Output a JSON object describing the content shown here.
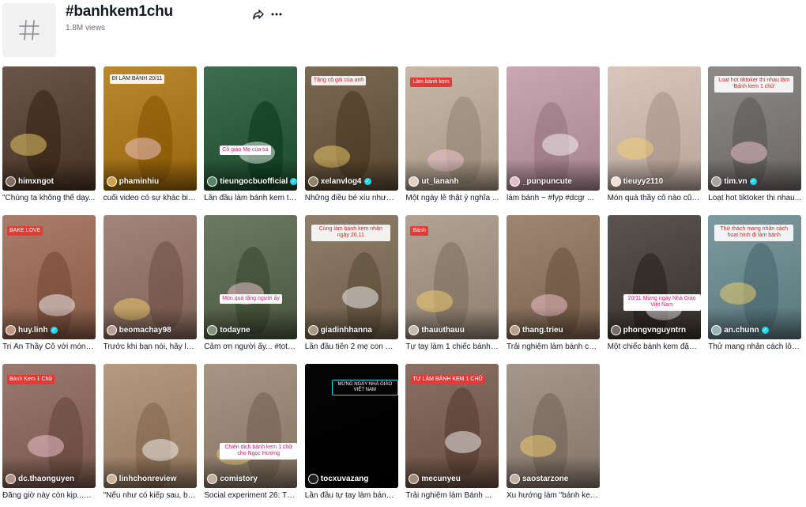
{
  "hashtag": {
    "title": "#banhkem1chu",
    "views": "1.8M views"
  },
  "icons": {
    "avatar": "hashtag-icon",
    "share": "share-icon",
    "more": "more-icon"
  },
  "videos": [
    {
      "user": "himxngot",
      "verified": false,
      "caption": "\"Chúng ta không thể dạy...",
      "bg": "#6a5648",
      "overlay": ""
    },
    {
      "user": "phaminhiu",
      "verified": false,
      "caption": "cuối video có sự khác biệ...",
      "bg": "#b9882f",
      "overlay": "ĐI LÀM BÁNH 20/11"
    },
    {
      "user": "tieungocbuofficial",
      "verified": true,
      "caption": "Lần đầu làm bánh kem ta...",
      "bg": "#3f6d4f",
      "overlay": "Cô giáo Mẹ của tui"
    },
    {
      "user": "xelanvlog4",
      "verified": true,
      "caption": "Những điều bé xíu nhưng...",
      "bg": "#7b6a54",
      "overlay": "Tặng cô gái của anh"
    },
    {
      "user": "ut_lananh",
      "verified": false,
      "caption": "Một ngày lễ thật ý nghĩa ...",
      "bg": "#c8b8a8",
      "overlay": "Làm bánh kem"
    },
    {
      "user": "_punpuncute",
      "verified": false,
      "caption": "làm bánh ~ #fyp #dcgr ...",
      "bg": "#c9a7b2",
      "overlay": ""
    },
    {
      "user": "tieuyy2110",
      "verified": false,
      "caption": "Món quà thầy cô nào cũn...",
      "bg": "#d9c7bd",
      "overlay": ""
    },
    {
      "user": "tim.vn",
      "verified": true,
      "caption": "Loạt hot tiktoker thi nhau...",
      "bg": "#8e8a8a",
      "overlay": "Loạt hot tiktoker thi nhau làm 'Bánh kem 1 chữ'"
    },
    {
      "user": "huy.linh",
      "verified": true,
      "caption": "Tri Ân Thầy Cô với món q...",
      "bg": "#a97d6a",
      "overlay": "BAKE LOVE"
    },
    {
      "user": "beomachay98",
      "verified": false,
      "caption": "Trước khi bạn nói, hãy lắn...",
      "bg": "#a2857a",
      "overlay": ""
    },
    {
      "user": "todayne",
      "verified": false,
      "caption": "Cảm ơn người ấy... #toto ...",
      "bg": "#6d7a63",
      "overlay": "Món quà tặng người ấy"
    },
    {
      "user": "giadinhhanna",
      "verified": false,
      "caption": "Lần đầu tiên 2 mẹ con Na...",
      "bg": "#8f7f6b",
      "overlay": "Cùng làm bánh kem nhân ngày 20.11"
    },
    {
      "user": "thauuthauu",
      "verified": false,
      "caption": "Tự tay làm 1 chiếc bánh k...",
      "bg": "#b2a294",
      "overlay": "Bánh"
    },
    {
      "user": "thang.trieu",
      "verified": false,
      "caption": "Trải nghiệm làm bánh của...",
      "bg": "#9e8672",
      "overlay": ""
    },
    {
      "user": "phongvnguyntrn",
      "verified": false,
      "caption": "Một chiếc bánh kem đặc ...",
      "bg": "#5b5550",
      "overlay": "20/11 Mừng ngày Nhà Giáo Việt Nam"
    },
    {
      "user": "an.chunn",
      "verified": true,
      "caption": "Thử mang nhân cách lôn...",
      "bg": "#7d9a9f",
      "overlay": "Thử thách mang nhân cách hoạt hình đi làm bánh"
    },
    {
      "user": "dc.thaonguyen",
      "verified": false,
      "caption": "Đăng giờ này còn kịp...? ...",
      "bg": "#9a7a6f",
      "overlay": "Bánh Kem 1 Chữ"
    },
    {
      "user": "linhchonreview",
      "verified": false,
      "caption": "\"Nếu như có kiếp sau, bạ...",
      "bg": "#b59a80",
      "overlay": ""
    },
    {
      "user": "comistory",
      "verified": false,
      "caption": "Social experiment 26: Th...",
      "bg": "#a79585",
      "overlay": "Chiến dịch bánh kem 1 chữ cho Ngọc Hương"
    },
    {
      "user": "tocxuvazang",
      "verified": false,
      "caption": "Lần đầu tự tay làm bánh t...",
      "bg": "#050505",
      "overlay": "MỪNG NGÀY NHÀ GIÁO VIỆT NAM"
    },
    {
      "user": "mecunyeu",
      "verified": false,
      "caption": "Trải nghiệm làm Bánh ...",
      "bg": "#8b7064",
      "overlay": "TỰ LÀM BÁNH KEM 1 CHỮ"
    },
    {
      "user": "saostarzone",
      "verified": false,
      "caption": "Xu hướng làm \"bánh kem ...",
      "bg": "#a6978c",
      "overlay": ""
    }
  ],
  "colors": {
    "accent_red": "#fe2c55",
    "verified_cyan": "#20d5ec",
    "text": "#161823",
    "muted": "#6b6d76"
  }
}
